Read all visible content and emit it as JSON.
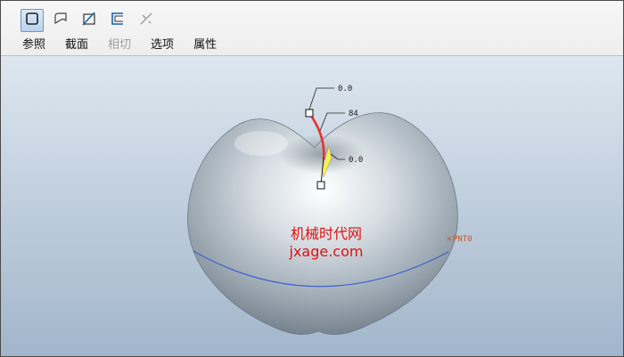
{
  "toolbar": {
    "tools": [
      {
        "name": "sketch-plane-tool",
        "icon": "sketch-plane-icon",
        "active": true
      },
      {
        "name": "surface-tool",
        "icon": "surface-icon",
        "active": false
      },
      {
        "name": "section-tool",
        "icon": "section-icon",
        "active": false
      },
      {
        "name": "boundary-tool",
        "icon": "boundary-icon",
        "active": false
      },
      {
        "name": "cross-tool",
        "icon": "cross-disabled-icon",
        "active": false
      }
    ]
  },
  "tabs": [
    {
      "label": "参照",
      "enabled": true
    },
    {
      "label": "截面",
      "enabled": true
    },
    {
      "label": "相切",
      "enabled": false
    },
    {
      "label": "选项",
      "enabled": true
    },
    {
      "label": "属性",
      "enabled": true
    }
  ],
  "viewport": {
    "dim_top": "0.0",
    "dim_mid": "84",
    "dim_bottom": "0.0",
    "point_label": "PNT0",
    "trajectory_color": "#e83030",
    "highlight_color": "#f5f050",
    "datum_curve_color": "#4060d0"
  },
  "watermark": {
    "line1": "机械时代网",
    "line2": "jxage.com"
  }
}
